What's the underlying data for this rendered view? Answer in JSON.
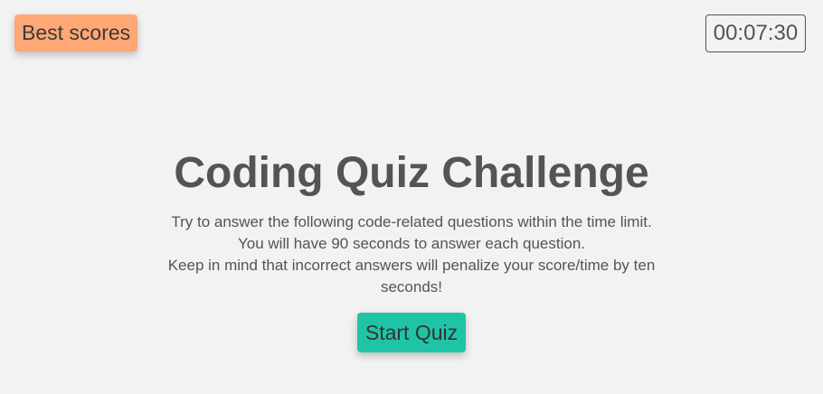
{
  "header": {
    "best_scores_label": "Best scores",
    "timer": "00:07:30"
  },
  "main": {
    "title": "Coding Quiz Challenge",
    "description": [
      "Try to answer the following code-related questions within the time limit.",
      "You will have 90 seconds to answer each question.",
      "Keep in mind that incorrect answers will penalize your score/time by ten seconds!"
    ],
    "start_label": "Start Quiz"
  },
  "colors": {
    "background": "#f2f2f2",
    "best_scores_button": "#ffa775",
    "start_button": "#1fc4a6",
    "text": "#545454"
  }
}
